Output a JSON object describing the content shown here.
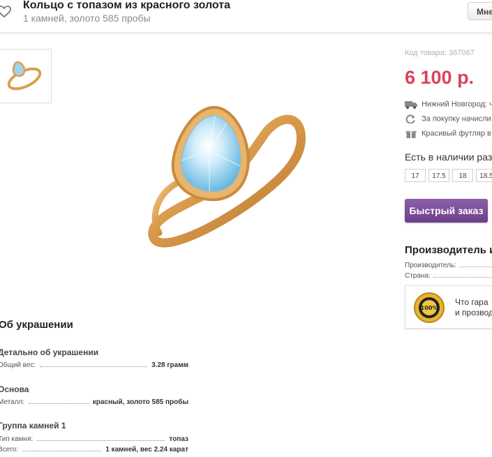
{
  "header": {
    "title": "Кольцо с топазом из красного золота",
    "subtitle": "1 камней, золото 585 пробы",
    "more_label": "Мне"
  },
  "gallery": {
    "thumb_icon": "ring-thumbnail",
    "main_icon": "ring-image"
  },
  "product": {
    "sku": "Код товара: 367067",
    "price": "6 100 р.",
    "price_color": "#d9435a",
    "delivery": "Нижний Новгород: ч",
    "bonus": "За покупку начисли",
    "gift": "Красивый футляр в"
  },
  "sizes": {
    "title": "Есть в наличии раз",
    "options": [
      "17",
      "17.5",
      "18",
      "18.5"
    ]
  },
  "quick_order": {
    "label": "Быстрый заказ",
    "color": "#7b4c99"
  },
  "manufacturer": {
    "title": "Производитель и",
    "producer_label": "Производитель:",
    "country_label": "Страна:"
  },
  "guarantee": {
    "line1": "Что гарa",
    "line2": "и прозвод",
    "seal_text": "100%"
  },
  "about": {
    "title": "Об украшении",
    "sections": [
      {
        "title": "Детально об украшении",
        "rows": [
          {
            "label": "Общий вес:",
            "value": "3.28 грамм"
          }
        ]
      },
      {
        "title": "Основа",
        "rows": [
          {
            "label": "Металл:",
            "value": "красный, золото 585 пробы"
          }
        ]
      },
      {
        "title": "Группа камней 1",
        "rows": [
          {
            "label": "Тип камня:",
            "value": "топаз"
          },
          {
            "label": "Всего:",
            "value": "1 камней, вес 2.24 карат"
          }
        ]
      }
    ]
  }
}
